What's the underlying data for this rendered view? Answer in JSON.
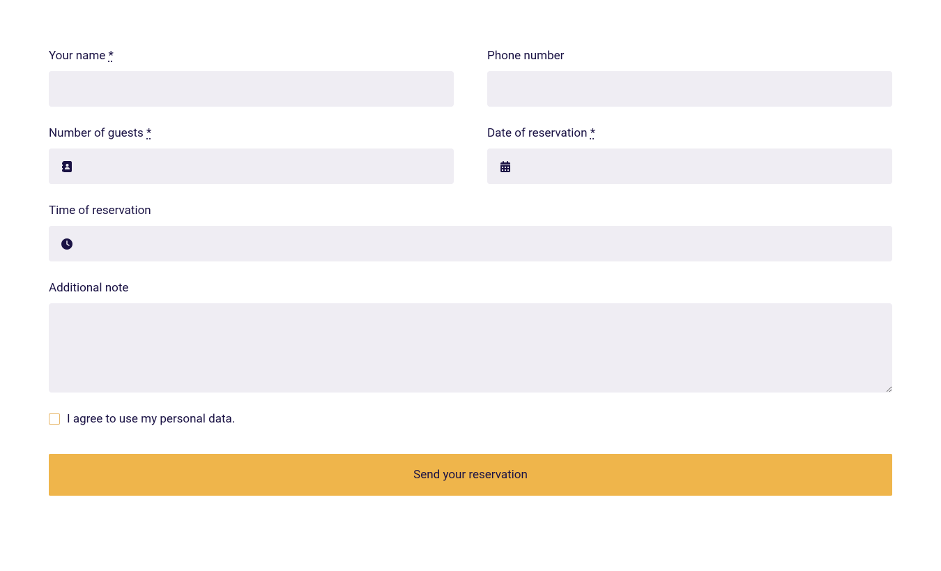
{
  "form": {
    "name": {
      "label": "Your name ",
      "required_mark": "*",
      "value": ""
    },
    "phone": {
      "label": "Phone number",
      "value": ""
    },
    "guests": {
      "label": "Number of guests ",
      "required_mark": "*",
      "value": ""
    },
    "date": {
      "label": "Date of reservation ",
      "required_mark": "*",
      "value": ""
    },
    "time": {
      "label": "Time of reservation",
      "value": ""
    },
    "note": {
      "label": "Additional note",
      "value": ""
    },
    "consent": {
      "label": "I agree to use my personal data.",
      "checked": false
    },
    "submit": {
      "label": "Send your reservation"
    }
  }
}
